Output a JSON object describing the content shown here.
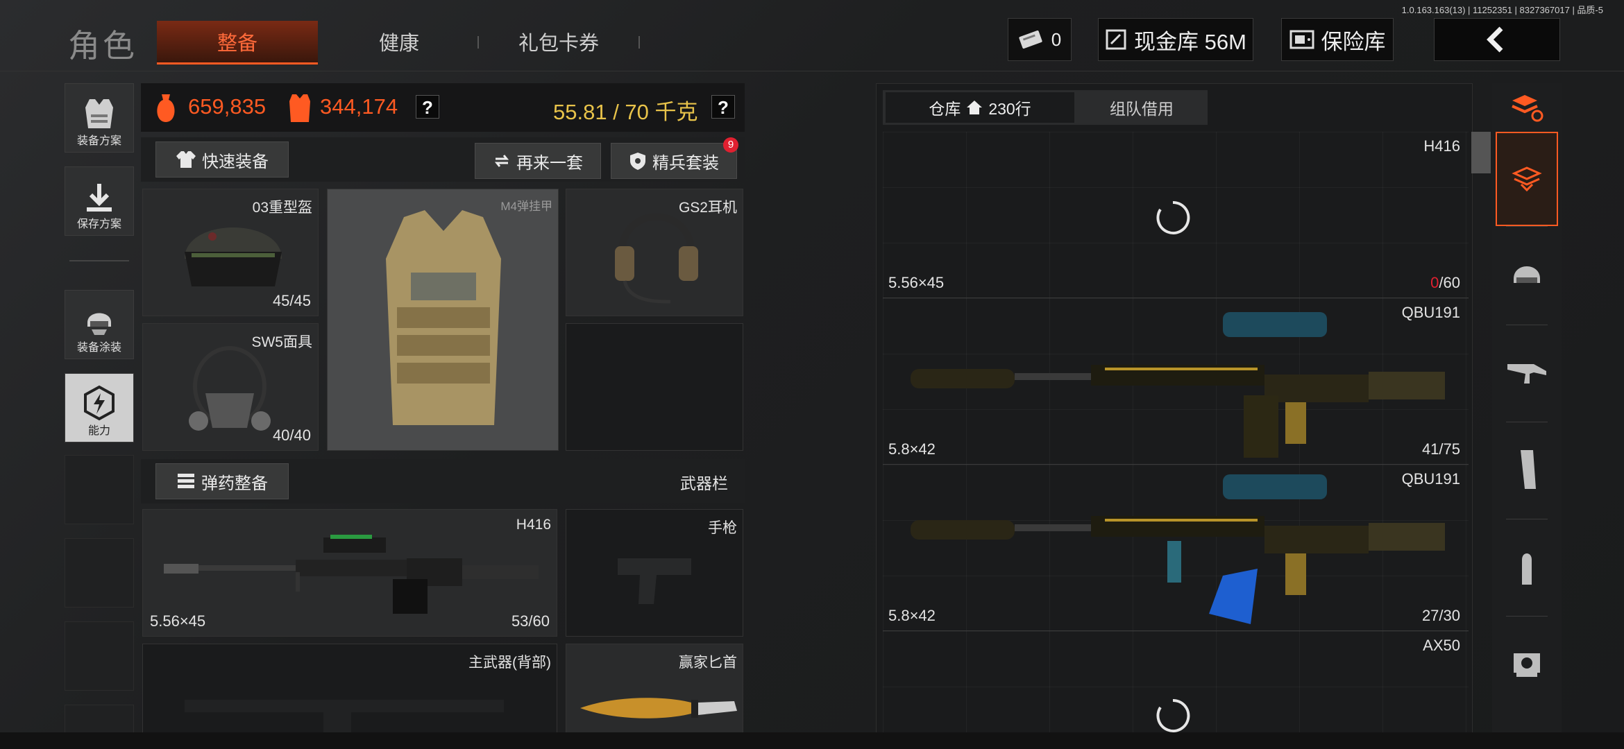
{
  "version": "1.0.163.163(13) | 11252351 | 8327367017 | 品质-5",
  "header": {
    "title": "角色",
    "tabs": [
      "整备",
      "健康",
      "礼包卡券"
    ],
    "active_tab": 0,
    "ticket_count": "0",
    "cash_label": "现金库 56M",
    "safe_label": "保险库"
  },
  "left_menu": [
    "装备方案",
    "保存方案",
    "装备涂装",
    "能力"
  ],
  "stats": {
    "value1": "659,835",
    "value2": "344,174",
    "weight": "55.81 / 70 千克",
    "help": "?"
  },
  "buttons": {
    "quick_equip": "快速装备",
    "again": "再来一套",
    "elite": "精兵套装",
    "elite_badge": "9",
    "ammo": "弹药整备"
  },
  "gear": {
    "helmet": {
      "name": "03重型盔",
      "dur": "45/45"
    },
    "armor": {
      "name": "M4弹挂甲"
    },
    "headset": {
      "name": "GS2耳机"
    },
    "mask": {
      "name": "SW5面具",
      "dur": "40/40"
    }
  },
  "weapons": {
    "label": "武器栏",
    "primary": {
      "name": "H416",
      "cal": "5.56×45",
      "ammo": "53/60"
    },
    "pistol": {
      "name": "手枪"
    },
    "back": {
      "name": "主武器(背部)"
    },
    "knife": {
      "name": "赢家匕首"
    }
  },
  "storage": {
    "tab_storage": "仓库",
    "rows": "230行",
    "tab_team": "组队借用",
    "items": [
      {
        "name": "H416",
        "cal": "5.56×45",
        "ammo_cur": "0",
        "ammo_max": "/60"
      },
      {
        "name": "QBU191",
        "cal": "5.8×42",
        "ammo": "41/75"
      },
      {
        "name": "QBU191",
        "cal": "5.8×42",
        "ammo": "27/30"
      },
      {
        "name": "AX50"
      }
    ]
  },
  "colors": {
    "accent": "#ff5a22",
    "orange_text": "#ff6a3a",
    "weight": "#e8c34a",
    "red": "#e02030"
  }
}
